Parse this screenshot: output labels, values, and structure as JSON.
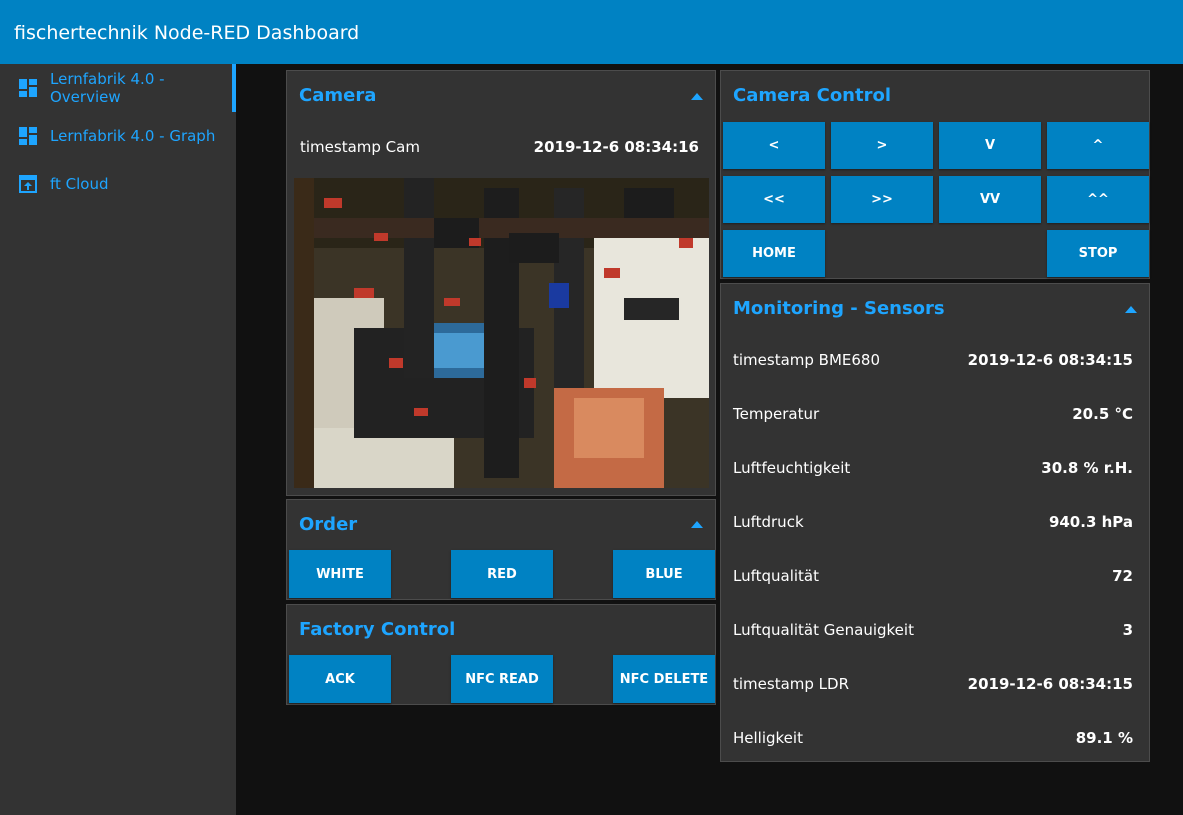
{
  "app": {
    "title": "fischertechnik Node-RED Dashboard"
  },
  "sidebar": {
    "items": [
      {
        "label": "Lernfabrik 4.0 - Overview",
        "icon": "dashboard-icon",
        "active": true
      },
      {
        "label": "Lernfabrik 4.0 - Graph",
        "icon": "dashboard-icon",
        "active": false
      },
      {
        "label": "ft Cloud",
        "icon": "open-in-browser-icon",
        "active": false
      }
    ]
  },
  "camera": {
    "title": "Camera",
    "timestamp_label": "timestamp Cam",
    "timestamp_value": "2019-12-6 08:34:16"
  },
  "order": {
    "title": "Order",
    "buttons": [
      "WHITE",
      "RED",
      "BLUE"
    ]
  },
  "factory": {
    "title": "Factory Control",
    "buttons": [
      "ACK",
      "NFC READ",
      "NFC DELETE"
    ]
  },
  "camera_control": {
    "title": "Camera Control",
    "buttons": [
      "<",
      ">",
      "V",
      "^",
      "<<",
      ">>",
      "VV",
      "^^",
      "HOME",
      "STOP"
    ]
  },
  "monitoring": {
    "title": "Monitoring - Sensors",
    "rows": [
      {
        "label": "timestamp BME680",
        "value": "2019-12-6 08:34:15"
      },
      {
        "label": "Temperatur",
        "value": "20.5 °C"
      },
      {
        "label": "Luftfeuchtigkeit",
        "value": "30.8 % r.H."
      },
      {
        "label": "Luftdruck",
        "value": "940.3 hPa"
      },
      {
        "label": "Luftqualität",
        "value": "72"
      },
      {
        "label": "Luftqualität Genauigkeit",
        "value": "3"
      },
      {
        "label": "timestamp LDR",
        "value": "2019-12-6 08:34:15"
      },
      {
        "label": "Helligkeit",
        "value": "89.1 %"
      }
    ]
  },
  "colors": {
    "accent": "#1ea5ff",
    "primary": "#0082c3",
    "panel": "#333333",
    "background": "#111111"
  }
}
